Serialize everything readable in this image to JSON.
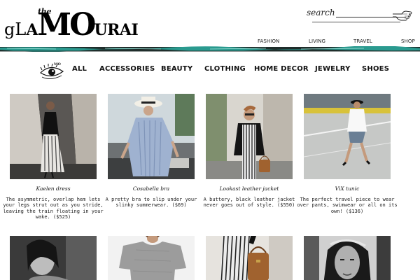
{
  "brand": {
    "the": "the",
    "part_g": "gL",
    "part_a": "A",
    "part_mo": "MO",
    "part_urai": "URAI"
  },
  "search": {
    "label": "search"
  },
  "top_nav": [
    "FASHION",
    "LIVING",
    "TRAVEL",
    "SHOP"
  ],
  "category_nav": [
    "ALL",
    "ACCESSORIES",
    "BEAUTY",
    "CLOTHING",
    "HOME DECOR",
    "JEWELRY",
    "SHOES"
  ],
  "colors": {
    "brush": "#2a9a8f",
    "brush_dark": "#1f2d2b"
  },
  "products": [
    {
      "name": "Kaelen dress",
      "description": "The asymmetric, overlap hem lets your legs strut out as you stride, leaving the train floating in your wake. ($525)",
      "image": "woman-in-striped-dress-photo"
    },
    {
      "name": "Cosabella bra",
      "description": "A pretty bra to slip under your slinky summerwear. ($69)",
      "image": "woman-in-hat-blue-dress-photo"
    },
    {
      "name": "Lookast leather jacket",
      "description": "A buttery, black leather jacket never goes out of style. ($550)",
      "image": "woman-in-leather-jacket-photo"
    },
    {
      "name": "ViX tunic",
      "description": "The perfect travel piece to wear over pants, swimwear or all on its own! ($136)",
      "image": "woman-walking-street-photo"
    }
  ],
  "products_row2": [
    {
      "image": "portrait-bw-photo"
    },
    {
      "image": "grey-tshirt-photo"
    },
    {
      "image": "brown-bag-photo"
    },
    {
      "image": "portrait-headband-photo"
    }
  ]
}
